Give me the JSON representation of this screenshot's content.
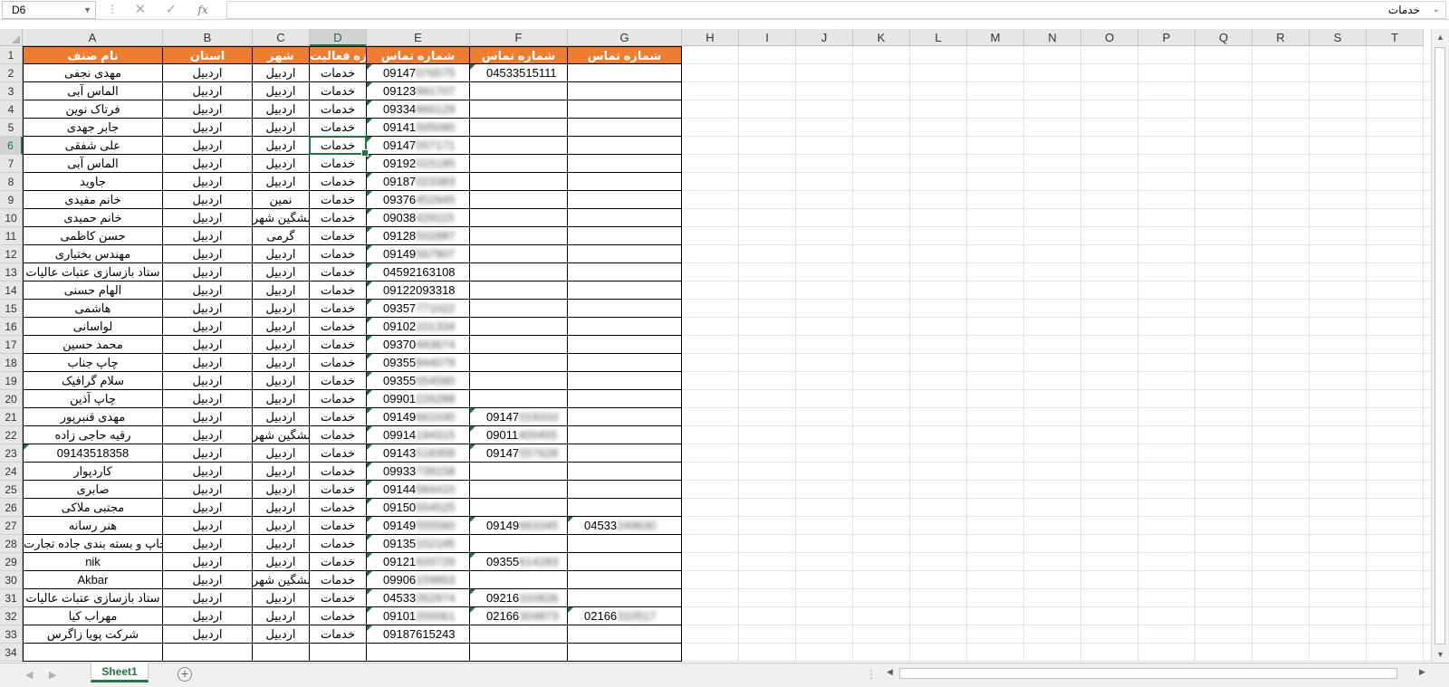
{
  "formula_bar": {
    "name_box": "D6",
    "cancel_icon": "✕",
    "enter_icon": "✓",
    "fx_label": "fx",
    "formula_value": "خدمات"
  },
  "columns": [
    "A",
    "B",
    "C",
    "D",
    "E",
    "F",
    "G",
    "H",
    "I",
    "J",
    "K",
    "L",
    "M",
    "N",
    "O",
    "P",
    "Q",
    "R",
    "S",
    "T"
  ],
  "selected_column": "D",
  "selected_row": 6,
  "row_numbers": [
    1,
    2,
    3,
    4,
    5,
    6,
    7,
    8,
    9,
    10,
    11,
    12,
    13,
    14,
    15,
    16,
    17,
    18,
    19,
    20,
    21,
    22,
    23,
    24,
    25,
    26,
    27,
    28,
    29,
    30,
    31,
    32,
    33,
    34
  ],
  "table": {
    "headers": [
      "نام صنف",
      "استان",
      "شهر",
      "حوزه فعالیت",
      "شماره تماس",
      "شماره تماس",
      "شماره تماس"
    ],
    "rows": [
      {
        "a": "مهدی نجفی",
        "b": "اردبیل",
        "c": "اردبیل",
        "d": "خدمات",
        "e": "09147076575",
        "f": "04533515111",
        "g": ""
      },
      {
        "a": "الماس آبی",
        "b": "اردبیل",
        "c": "اردبیل",
        "d": "خدمات",
        "e": "09123991707",
        "f": "",
        "g": ""
      },
      {
        "a": "فرتاک نوین",
        "b": "اردبیل",
        "c": "اردبیل",
        "d": "خدمات",
        "e": "09334966129",
        "f": "",
        "g": ""
      },
      {
        "a": "جابر جهدی",
        "b": "اردبیل",
        "c": "اردبیل",
        "d": "خدمات",
        "e": "09141505090",
        "f": "",
        "g": ""
      },
      {
        "a": "علی شفقی",
        "b": "اردبیل",
        "c": "اردبیل",
        "d": "خدمات",
        "e": "09147057171",
        "f": "",
        "g": ""
      },
      {
        "a": "الماس آبی",
        "b": "اردبیل",
        "c": "اردبیل",
        "d": "خدمات",
        "e": "09192015185",
        "f": "",
        "g": ""
      },
      {
        "a": "جاوید",
        "b": "اردبیل",
        "c": "اردبیل",
        "d": "خدمات",
        "e": "09187023383",
        "f": "",
        "g": ""
      },
      {
        "a": "خانم مفیدی",
        "b": "اردبیل",
        "c": "نمین",
        "d": "خدمات",
        "e": "09376452945",
        "f": "",
        "g": ""
      },
      {
        "a": "خانم حمیدی",
        "b": "اردبیل",
        "c": "مشگین شهر",
        "d": "خدمات",
        "e": "09038429115",
        "f": "",
        "g": ""
      },
      {
        "a": "حسن کاظمی",
        "b": "اردبیل",
        "c": "گرمی",
        "d": "خدمات",
        "e": "09128502887",
        "f": "",
        "g": ""
      },
      {
        "a": "مهندس بختیاری",
        "b": "اردبیل",
        "c": "اردبیل",
        "d": "خدمات",
        "e": "09149567907",
        "f": "",
        "g": ""
      },
      {
        "a": "ستاد بازسازی عتبات عالیات",
        "b": "اردبیل",
        "c": "اردبیل",
        "d": "خدمات",
        "e": "04592163108",
        "f": "",
        "g": ""
      },
      {
        "a": "الهام حسنی",
        "b": "اردبیل",
        "c": "اردبیل",
        "d": "خدمات",
        "e": "09122093318",
        "f": "",
        "g": ""
      },
      {
        "a": "هاشمی",
        "b": "اردبیل",
        "c": "اردبیل",
        "d": "خدمات",
        "e": "09357771022",
        "f": "",
        "g": ""
      },
      {
        "a": "لواسانی",
        "b": "اردبیل",
        "c": "اردبیل",
        "d": "خدمات",
        "e": "09102101334",
        "f": "",
        "g": ""
      },
      {
        "a": "محمد حسین",
        "b": "اردبیل",
        "c": "اردبیل",
        "d": "خدمات",
        "e": "09370493674",
        "f": "",
        "g": ""
      },
      {
        "a": "چاپ جناب",
        "b": "اردبیل",
        "c": "اردبیل",
        "d": "خدمات",
        "e": "09355844079",
        "f": "",
        "g": ""
      },
      {
        "a": "سلام گرافیک",
        "b": "اردبیل",
        "c": "اردبیل",
        "d": "خدمات",
        "e": "09355054580",
        "f": "",
        "g": ""
      },
      {
        "a": "چاپ آذین",
        "b": "اردبیل",
        "c": "اردبیل",
        "d": "خدمات",
        "e": "09901226288",
        "f": "",
        "g": ""
      },
      {
        "a": "مهدی قنبرپور",
        "b": "اردبیل",
        "c": "اردبیل",
        "d": "خدمات",
        "e": "09149661030",
        "f": "09147019310",
        "g": ""
      },
      {
        "a": "رقیه حاجی زاده",
        "b": "اردبیل",
        "c": "مشگین شهر",
        "d": "خدمات",
        "e": "09914194315",
        "f": "09011400455",
        "g": ""
      },
      {
        "a": "09143518358",
        "b": "اردبیل",
        "c": "اردبیل",
        "d": "خدمات",
        "e": "09143518358",
        "f": "09147557628",
        "g": ""
      },
      {
        "a": "کاردپوار",
        "b": "اردبیل",
        "c": "اردبیل",
        "d": "خدمات",
        "e": "09933739158",
        "f": "",
        "g": ""
      },
      {
        "a": "صابری",
        "b": "اردبیل",
        "c": "اردبیل",
        "d": "خدمات",
        "e": "09144584410",
        "f": "",
        "g": ""
      },
      {
        "a": "مجتبی ملاکی",
        "b": "اردبیل",
        "c": "اردبیل",
        "d": "خدمات",
        "e": "09150554525",
        "f": "",
        "g": ""
      },
      {
        "a": "هنر رسانه",
        "b": "اردبیل",
        "c": "اردبیل",
        "d": "خدمات",
        "e": "09149555560",
        "f": "09149663345",
        "g": "04533249630"
      },
      {
        "a": "صنایع چاپ و بسته بندی جاده تجارت",
        "b": "اردبیل",
        "c": "اردبیل",
        "d": "خدمات",
        "e": "09135102195",
        "f": "",
        "g": ""
      },
      {
        "a": "nik",
        "b": "اردبیل",
        "c": "اردبیل",
        "d": "خدمات",
        "e": "09121933729",
        "f": "09355614283",
        "g": ""
      },
      {
        "a": "Akbar",
        "b": "اردبیل",
        "c": "مشگین شهر",
        "d": "خدمات",
        "e": "09906159863",
        "f": "",
        "g": ""
      },
      {
        "a": "ستاد بازسازی عتبات عالیات",
        "b": "اردبیل",
        "c": "اردبیل",
        "d": "خدمات",
        "e": "04533262974",
        "f": "09216310826",
        "g": ""
      },
      {
        "a": "مهراب کیا",
        "b": "اردبیل",
        "c": "اردبیل",
        "d": "خدمات",
        "e": "09101200061",
        "f": "02166304873",
        "g": "02166310517"
      },
      {
        "a": "شرکت پویا زاگرس",
        "b": "اردبیل",
        "c": "اردبیل",
        "d": "خدمات",
        "e": "09187615243",
        "f": "",
        "g": ""
      }
    ]
  },
  "sheet_tab": "Sheet1",
  "add_sheet": "+",
  "colors": {
    "header_fill": "#ed7d31",
    "accent": "#217346"
  }
}
